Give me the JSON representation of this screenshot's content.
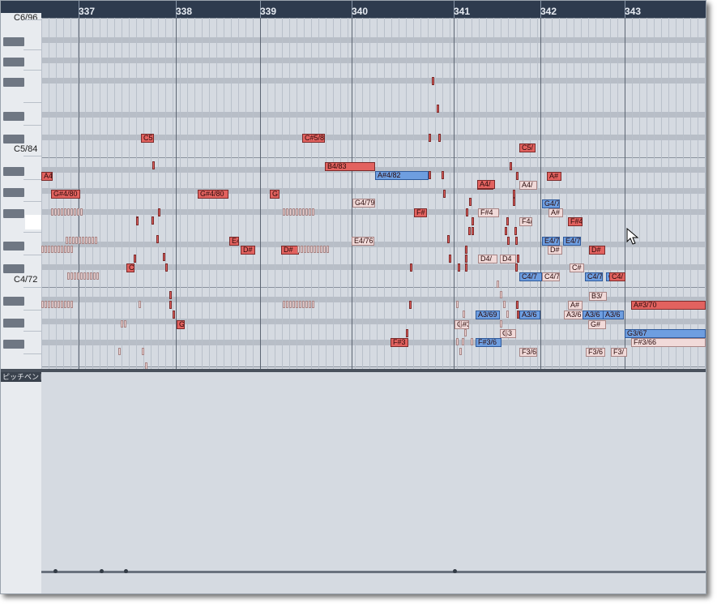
{
  "ruler": {
    "bars": [
      "337",
      "338",
      "339",
      "340",
      "341",
      "342",
      "343"
    ]
  },
  "keyboard": {
    "labels": [
      "C6/96",
      "C5/84",
      "C4/72"
    ]
  },
  "pitch_bend": {
    "label": "ピッチベンド"
  },
  "notes": [
    {
      "label": "A4/",
      "style": "red"
    },
    {
      "label": "G#4/80",
      "style": "red"
    },
    {
      "label": "C5",
      "style": "red"
    },
    {
      "label": "G#4/80",
      "style": "red"
    },
    {
      "label": "G",
      "style": "red"
    },
    {
      "label": "C#5/8",
      "style": "red"
    },
    {
      "label": "B4/83",
      "style": "red"
    },
    {
      "label": "A#4/82",
      "style": "blue"
    },
    {
      "label": "A4",
      "style": "red"
    },
    {
      "label": "E4",
      "style": "red"
    },
    {
      "label": "D#",
      "style": "red"
    },
    {
      "label": "D#",
      "style": "red"
    },
    {
      "label": "E4/76",
      "style": "pink"
    },
    {
      "label": "G4/79",
      "style": "pink"
    },
    {
      "label": "F#",
      "style": "red"
    },
    {
      "label": "C",
      "style": "red"
    },
    {
      "label": "G",
      "style": "red"
    },
    {
      "label": "F#3",
      "style": "red"
    },
    {
      "label": "C5/",
      "style": "red"
    },
    {
      "label": "A4/",
      "style": "red"
    },
    {
      "label": "A4/",
      "style": "pink"
    },
    {
      "label": "A#",
      "style": "red"
    },
    {
      "label": "G4/7",
      "style": "blue"
    },
    {
      "label": "A#",
      "style": "pink"
    },
    {
      "label": "F#4",
      "style": "pink"
    },
    {
      "label": "F4/",
      "style": "pink"
    },
    {
      "label": "F#4",
      "style": "red"
    },
    {
      "label": "E4/7",
      "style": "blue"
    },
    {
      "label": "E4/7",
      "style": "blue"
    },
    {
      "label": "D#",
      "style": "pink"
    },
    {
      "label": "D#",
      "style": "red"
    },
    {
      "label": "D4/",
      "style": "pink"
    },
    {
      "label": "D4",
      "style": "pink"
    },
    {
      "label": "C#",
      "style": "pink"
    },
    {
      "label": "C4/7",
      "style": "blue"
    },
    {
      "label": "C4/7",
      "style": "pink"
    },
    {
      "label": "C4/7",
      "style": "blue"
    },
    {
      "label": "C4/7",
      "style": "blue"
    },
    {
      "label": "C4/",
      "style": "red"
    },
    {
      "label": "B3/",
      "style": "pink"
    },
    {
      "label": "A#",
      "style": "pink"
    },
    {
      "label": "A#3/70",
      "style": "red"
    },
    {
      "label": "A3/69",
      "style": "blue"
    },
    {
      "label": "A3/6",
      "style": "blue"
    },
    {
      "label": "A3/6",
      "style": "pink"
    },
    {
      "label": "A3/6",
      "style": "blue"
    },
    {
      "label": "A3/6",
      "style": "blue"
    },
    {
      "label": "G#",
      "style": "pink"
    },
    {
      "label": "G#3",
      "style": "pink"
    },
    {
      "label": "G3/67",
      "style": "blue"
    },
    {
      "label": "G3",
      "style": "pink"
    },
    {
      "label": "F#3/6",
      "style": "blue"
    },
    {
      "label": "F#3/66",
      "style": "pink"
    },
    {
      "label": "F3/6",
      "style": "pink"
    },
    {
      "label": "F3/6",
      "style": "pink"
    },
    {
      "label": "F3/",
      "style": "pink"
    },
    {
      "label": "B3",
      "style": "pink"
    }
  ],
  "colors": {
    "ruler_bg": "#2e3b4e",
    "note_red": "#e2625f",
    "note_pink": "#f1dad9",
    "note_blue": "#6e9ee0",
    "grid_bg": "#d5dae1"
  }
}
